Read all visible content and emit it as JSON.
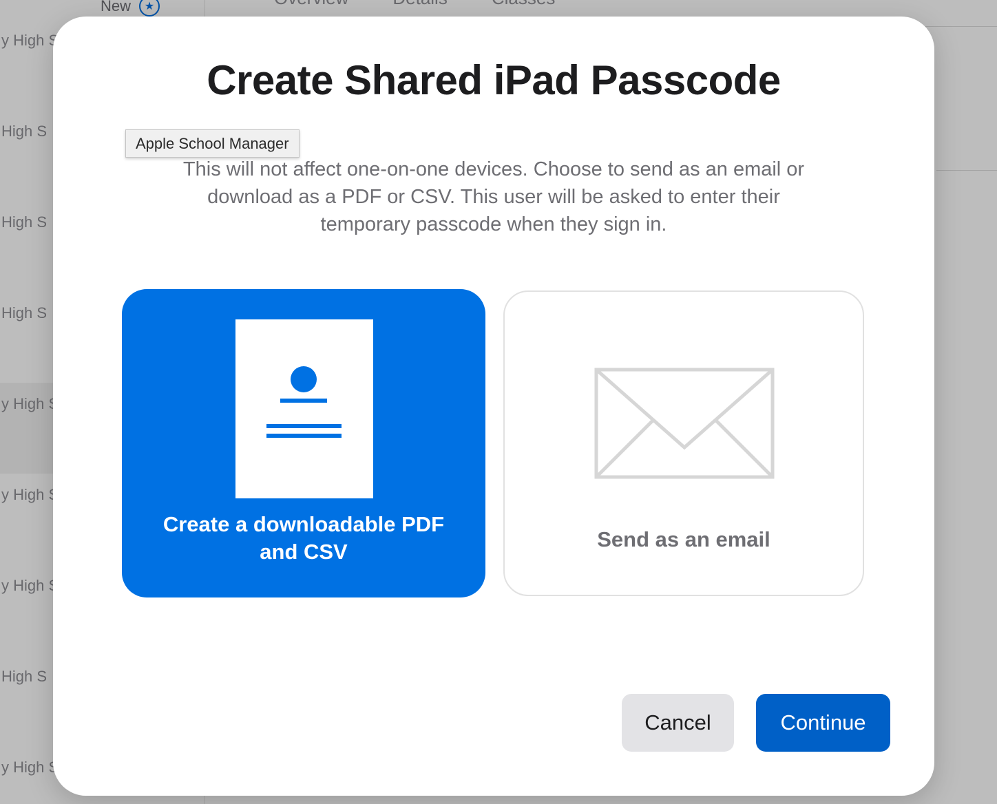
{
  "background": {
    "sidebar_new_label": "New",
    "sidebar_rows": [
      "y High S",
      "High S",
      "High S",
      "High S",
      "y High S",
      "y High S",
      "y High S",
      "High S",
      "y High S"
    ],
    "tabs": [
      "Overview",
      "Details",
      "Classes"
    ]
  },
  "tooltip": {
    "text": "Apple School Manager"
  },
  "modal": {
    "title": "Create Shared iPad Passcode",
    "description": "This will not affect one-on-one devices. Choose to send as an email or download as a PDF or CSV. This user will be asked to enter their temporary passcode when they sign in.",
    "options": [
      {
        "label": "Create a downloadable PDF and CSV",
        "icon": "document-icon",
        "selected": true
      },
      {
        "label": "Send as an email",
        "icon": "envelope-icon",
        "selected": false
      }
    ],
    "buttons": {
      "cancel": "Cancel",
      "continue": "Continue"
    }
  },
  "colors": {
    "accent": "#0071e3",
    "continue_button": "#0060c7",
    "muted_text": "#6e6e73"
  }
}
